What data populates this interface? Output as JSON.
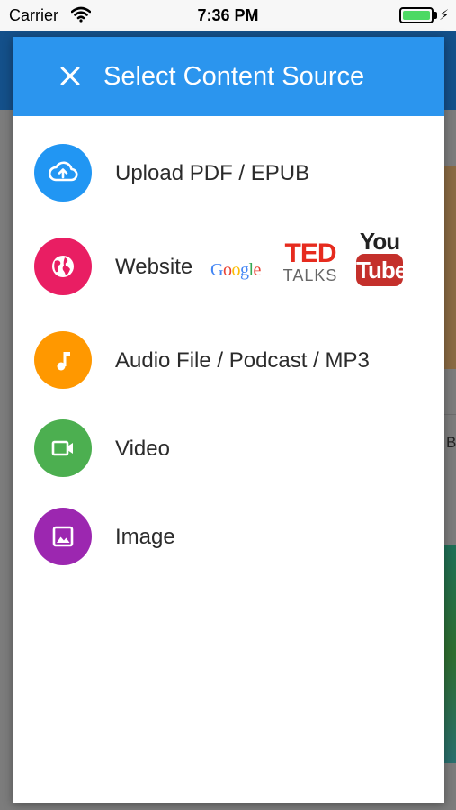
{
  "status_bar": {
    "carrier": "Carrier",
    "time": "7:36 PM",
    "battery_level": 1.0,
    "battery_color": "#4cd964"
  },
  "background": {
    "partial_text": "B"
  },
  "dialog": {
    "title": "Select Content Source",
    "header_color": "#2b95ee",
    "close_icon": "close-icon",
    "options": [
      {
        "label": "Upload PDF / EPUB",
        "icon": "cloud-upload-icon",
        "color": "#2196f3"
      },
      {
        "label": "Website",
        "icon": "globe-icon",
        "color": "#e91e63",
        "logos": {
          "google": [
            "G",
            "o",
            "o",
            "g",
            "l",
            "e"
          ],
          "ted_top": "TED",
          "ted_bottom": "TALKS",
          "youtube_you": "You",
          "youtube_tube": "Tube"
        }
      },
      {
        "label": "Audio File / Podcast / MP3",
        "icon": "music-note-icon",
        "color": "#ff9800"
      },
      {
        "label": "Video",
        "icon": "video-camera-icon",
        "color": "#4caf50"
      },
      {
        "label": "Image",
        "icon": "image-icon",
        "color": "#9c27b0"
      }
    ]
  }
}
